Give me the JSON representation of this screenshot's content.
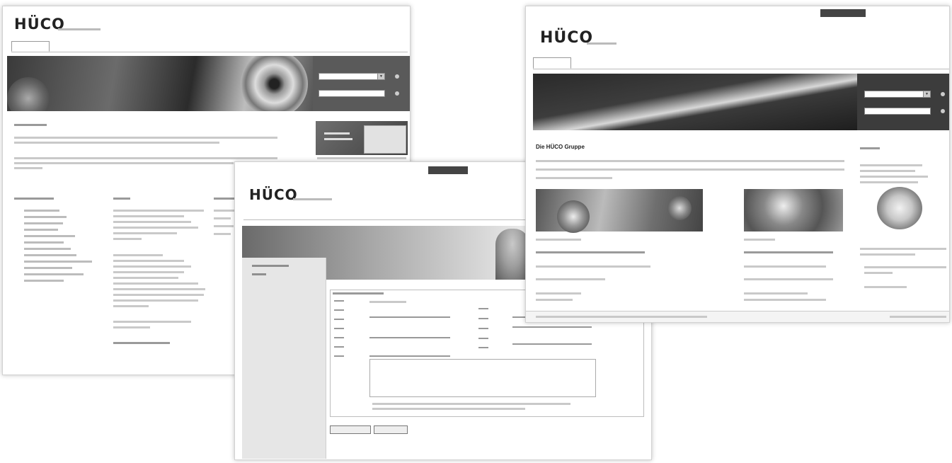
{
  "brand": {
    "logo_text": "HÜCO"
  },
  "screenshot_left": {
    "nav_tabs": [
      "",
      "",
      "",
      "",
      "",
      "",
      "",
      ""
    ],
    "selects": {
      "first": "",
      "second": ""
    }
  },
  "screenshot_middle": {
    "top_tabs": [
      "",
      ""
    ],
    "nav_tabs": [
      "",
      "",
      "",
      "",
      "",
      "",
      "",
      ""
    ],
    "buttons": {
      "submit": "",
      "reset": ""
    }
  },
  "screenshot_right": {
    "top_tabs": [
      "",
      "",
      ""
    ],
    "nav_tabs": [
      "",
      "",
      "",
      "",
      ""
    ],
    "heading": "Die HÜCO Gruppe",
    "selects": {
      "first": "",
      "second": ""
    }
  }
}
